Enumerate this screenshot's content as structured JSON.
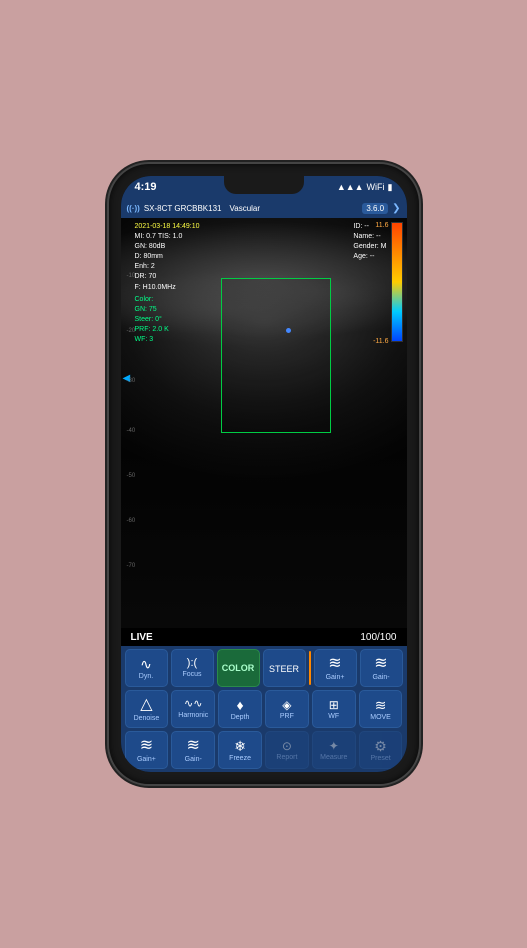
{
  "phone": {
    "status_bar": {
      "time": "4:19",
      "signal": "▲▲▲",
      "wifi": "WiFi",
      "battery": "🔋"
    },
    "header": {
      "brand_icon": "((·))",
      "brand_label": "SX-8CT GRCBBK131",
      "mode": "Vascular",
      "version": "3.6.0",
      "arrow": "❯"
    },
    "scan": {
      "timestamp": "2021-03-18 14:49:10",
      "mi": "MI: 0.7",
      "tis": "TIS: 1.0",
      "gn": "GN: 80dB",
      "depth": "D: 80mm",
      "enh": "Enh: 2",
      "dr": "DR: 70",
      "freq": "F: H10.0MHz",
      "color": "Color:",
      "color_gn": "GN: 75",
      "steer": "Steer: 0°",
      "prf": "PRF: 2.0 K",
      "wf": "WF: 3",
      "id": "ID: --",
      "name": "Name: --",
      "gender": "Gender: M",
      "age": "Age: --",
      "scale_top": "11.6",
      "scale_bottom": "-11.6"
    },
    "live_bar": {
      "live_label": "LIVE",
      "frame_count": "100/100"
    },
    "controls": {
      "row1": [
        {
          "icon": "∿",
          "label": "Dyn.",
          "active": false
        },
        {
          "icon": "):( ",
          "label": "Focus",
          "active": false
        },
        {
          "icon": "",
          "label": "COLOR",
          "active": true,
          "highlight": true
        },
        {
          "icon": "",
          "label": "STEER",
          "active": false
        },
        {
          "separator": true
        },
        {
          "icon": "≋",
          "label": "Gain+",
          "active": false
        },
        {
          "icon": "≋",
          "label": "Gain-",
          "active": false
        }
      ],
      "row2": [
        {
          "icon": "△",
          "label": "Denoise",
          "active": false
        },
        {
          "icon": "∿∿",
          "label": "Harmonic",
          "active": false
        },
        {
          "icon": "♦",
          "label": "Depth",
          "active": false
        },
        {
          "icon": "",
          "label": "PRF",
          "active": false
        },
        {
          "icon": "",
          "label": "WF",
          "active": false
        },
        {
          "icon": "",
          "label": "MOVE",
          "active": false
        }
      ],
      "row3": [
        {
          "icon": "≋",
          "label": "Gain+",
          "active": false
        },
        {
          "icon": "≋",
          "label": "Gain-",
          "active": false
        },
        {
          "icon": "❄",
          "label": "Freeze",
          "active": false
        },
        {
          "icon": "⊙",
          "label": "Report",
          "active": false,
          "disabled": true
        },
        {
          "icon": "✦",
          "label": "Measure",
          "active": false,
          "disabled": true
        },
        {
          "icon": "⚙",
          "label": "Preset",
          "active": false,
          "disabled": true
        }
      ]
    }
  }
}
